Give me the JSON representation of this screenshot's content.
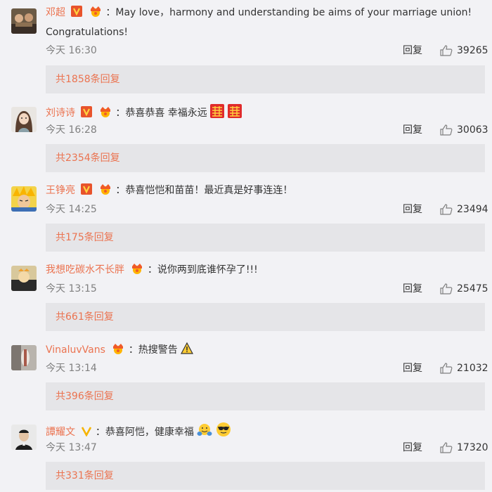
{
  "comments": [
    {
      "name": "邓超",
      "text": "：May love，harmony and understanding be aims of your marriage union!",
      "text2": "Congratulations!",
      "time": "今天 16:30",
      "reply_label": "回复",
      "likes": "39265",
      "replies": "共1858条回复",
      "verified": "red-v-badge",
      "member": "member-crown-badge"
    },
    {
      "name": "刘诗诗",
      "text": "：恭喜恭喜 幸福永远",
      "time": "今天 16:28",
      "reply_label": "回复",
      "likes": "30063",
      "replies": "共2354条回复",
      "verified": "red-v-badge",
      "member": "member-crown-badge",
      "emoji": [
        "double-happiness-emoji",
        "double-happiness-emoji"
      ]
    },
    {
      "name": "王铮亮",
      "text": "：恭喜恺恺和苗苗！最近真是好事连连！",
      "time": "今天 14:25",
      "reply_label": "回复",
      "likes": "23494",
      "replies": "共175条回复",
      "verified": "red-v-badge",
      "member": "member-crown-badge"
    },
    {
      "name": "我想吃碳水不长胖",
      "text": "：说你两到底谁怀孕了!!!",
      "time": "今天 13:15",
      "reply_label": "回复",
      "likes": "25475",
      "replies": "共661条回复",
      "member": "member-crown-badge"
    },
    {
      "name": "VinaluvVans",
      "text": "：热搜警告",
      "time": "今天 13:14",
      "reply_label": "回复",
      "likes": "21032",
      "replies": "共396条回复",
      "member": "member-crown-badge",
      "emoji": [
        "warning-emoji"
      ]
    },
    {
      "name": "譚耀文",
      "text": "：恭喜阿恺，健康幸福",
      "time": "今天 13:47",
      "reply_label": "回复",
      "likes": "17320",
      "replies": "共331条回复",
      "verified": "yellow-v-badge",
      "emoji": [
        "hugging-emoji",
        "sunglasses-emoji"
      ]
    }
  ],
  "colors": {
    "name": "#eb7350",
    "link": "#eb7350",
    "background": "#f2f2f5",
    "reply_box": "#e5e5e8",
    "muted": "#808080"
  }
}
